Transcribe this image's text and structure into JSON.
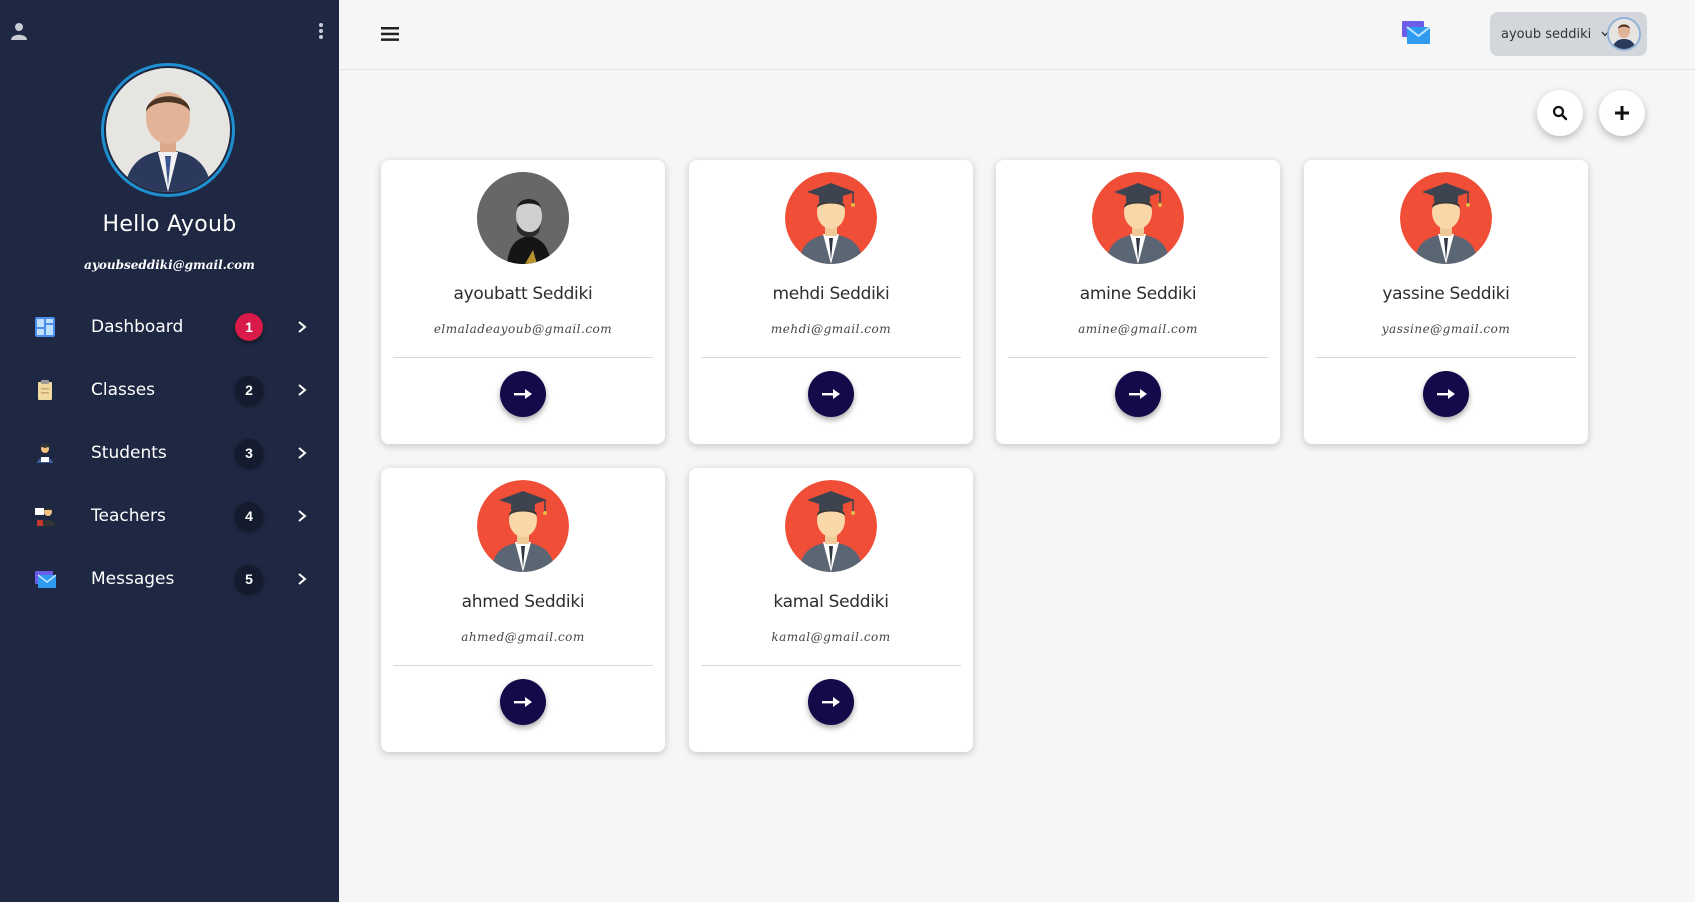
{
  "sidebar": {
    "greeting": "Hello Ayoub",
    "email": "ayoubseddiki@gmail.com",
    "items": [
      {
        "label": "Dashboard",
        "badge": "1",
        "icon": "dashboard-icon",
        "active": true
      },
      {
        "label": "Classes",
        "badge": "2",
        "icon": "clipboard-icon"
      },
      {
        "label": "Students",
        "badge": "3",
        "icon": "student-icon"
      },
      {
        "label": "Teachers",
        "badge": "4",
        "icon": "teacher-icon"
      },
      {
        "label": "Messages",
        "badge": "5",
        "icon": "envelope-icon"
      }
    ]
  },
  "topbar": {
    "user_name": "ayoub seddiki"
  },
  "colors": {
    "sidebar_bg": "#1e2842",
    "badge_active": "#d81b48",
    "arrow_button": "#140a4a",
    "avatar_orange": "#f04e37"
  },
  "cards": [
    {
      "name": "ayoubatt Seddiki",
      "email": "elmaladeayoub@gmail.com",
      "avatar": "photo"
    },
    {
      "name": "mehdi Seddiki",
      "email": "mehdi@gmail.com",
      "avatar": "graduate"
    },
    {
      "name": "amine Seddiki",
      "email": "amine@gmail.com",
      "avatar": "graduate"
    },
    {
      "name": "yassine Seddiki",
      "email": "yassine@gmail.com",
      "avatar": "graduate"
    },
    {
      "name": "ahmed Seddiki",
      "email": "ahmed@gmail.com",
      "avatar": "graduate"
    },
    {
      "name": "kamal Seddiki",
      "email": "kamal@gmail.com",
      "avatar": "graduate"
    }
  ]
}
